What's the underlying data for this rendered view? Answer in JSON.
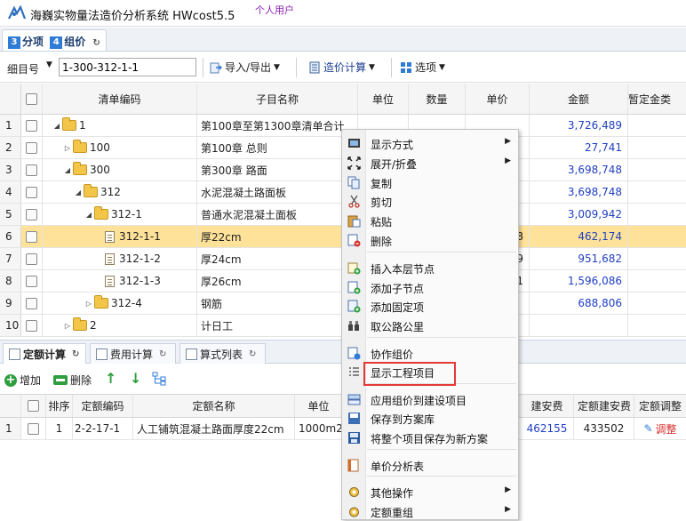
{
  "app": {
    "title": "海巍实物量法造价分析系统 HWcost5.5",
    "user": "个人用户"
  },
  "doc_tab": {
    "num1": "3",
    "label1": "分项",
    "num2": "4",
    "label2": "组价"
  },
  "toolbar": {
    "item_label": "细目号",
    "item_value": "1-300-312-1-1",
    "import_export": "导入/导出",
    "calc": "造价计算",
    "options": "选项"
  },
  "grid": {
    "headers": [
      "清单编码",
      "子目名称",
      "单位",
      "数量",
      "单价",
      "金额",
      "暂定金类"
    ],
    "rows": [
      {
        "n": "1",
        "indent": 0,
        "toggle": "▲",
        "icon": "folder",
        "code": "1",
        "name": "第100章至第1300章清单合计",
        "price": "",
        "amount": "3,726,489"
      },
      {
        "n": "2",
        "indent": 1,
        "toggle": "▷",
        "icon": "folder",
        "code": "100",
        "name": "第100章 总则",
        "price": "",
        "amount": "27,741"
      },
      {
        "n": "3",
        "indent": 1,
        "toggle": "▲",
        "icon": "folder",
        "code": "300",
        "name": "第300章 路面",
        "price": "",
        "amount": "3,698,748"
      },
      {
        "n": "4",
        "indent": 2,
        "toggle": "▲",
        "icon": "folder",
        "code": "312",
        "name": "水泥混凝土路面板",
        "price": "",
        "amount": "3,698,748"
      },
      {
        "n": "5",
        "indent": 3,
        "toggle": "▲",
        "icon": "folder",
        "code": "312-1",
        "name": "普通水泥混凝土面板",
        "price": "",
        "amount": "3,009,942"
      },
      {
        "n": "6",
        "indent": 4,
        "toggle": "",
        "icon": "doc",
        "code": "312-1-1",
        "name": "厚22cm",
        "price": "8",
        "amount": "462,174",
        "selected": true
      },
      {
        "n": "7",
        "indent": 4,
        "toggle": "",
        "icon": "doc",
        "code": "312-1-2",
        "name": "厚24cm",
        "price": "9",
        "amount": "951,682"
      },
      {
        "n": "8",
        "indent": 4,
        "toggle": "",
        "icon": "doc",
        "code": "312-1-3",
        "name": "厚26cm",
        "price": "1",
        "amount": "1,596,086"
      },
      {
        "n": "9",
        "indent": 3,
        "toggle": "▷",
        "icon": "folder",
        "code": "312-4",
        "name": "钢筋",
        "price": "",
        "amount": "688,806"
      },
      {
        "n": "10",
        "indent": 1,
        "toggle": "▷",
        "icon": "folder",
        "code": "2",
        "name": "计日工",
        "price": "",
        "amount": ""
      }
    ]
  },
  "bottom_tabs": [
    "定额计算",
    "费用计算",
    "算式列表"
  ],
  "bottom_toolbar": {
    "add": "增加",
    "delete": "删除"
  },
  "subgrid": {
    "headers": {
      "seq": "排序",
      "code": "定额编码",
      "name": "定额名称",
      "unit": "单位",
      "jaf": "建安费",
      "djaf": "定额建安费",
      "adjust": "定额调整"
    },
    "row": {
      "n": "1",
      "seq": "1",
      "code": "2-2-17-1",
      "name": "人工铺筑混凝土路面厚度22cm",
      "unit": "1000m2",
      "jaf": "462155",
      "djaf": "433502",
      "adjust": "调整"
    }
  },
  "context_menu": {
    "items": [
      {
        "icon": "display-icon",
        "label": "显示方式",
        "sub": true
      },
      {
        "icon": "expand-icon",
        "label": "展开/折叠",
        "sub": true
      },
      {
        "icon": "copy-icon",
        "label": "复制"
      },
      {
        "icon": "cut-icon",
        "label": "剪切"
      },
      {
        "icon": "paste-icon",
        "label": "粘贴"
      },
      {
        "icon": "delete-icon",
        "label": "删除"
      },
      {
        "icon": "insert-node-icon",
        "label": "插入本层节点"
      },
      {
        "icon": "add-child-icon",
        "label": "添加子节点"
      },
      {
        "icon": "add-fixed-icon",
        "label": "添加固定项"
      },
      {
        "icon": "road-km-icon",
        "label": "取公路公里"
      },
      {
        "icon": "collab-icon",
        "label": "协作组价"
      },
      {
        "icon": "list-icon",
        "label": "显示工程项目"
      },
      {
        "icon": "apply-icon",
        "label": "应用组价到建设项目"
      },
      {
        "icon": "save-lib-icon",
        "label": "保存到方案库"
      },
      {
        "icon": "save-new-icon",
        "label": "将整个项目保存为新方案"
      },
      {
        "icon": "analysis-icon",
        "label": "单价分析表"
      },
      {
        "icon": "other-icon",
        "label": "其他操作",
        "sub": true
      },
      {
        "icon": "regroup-icon",
        "label": "定额重组",
        "sub": true
      }
    ]
  }
}
